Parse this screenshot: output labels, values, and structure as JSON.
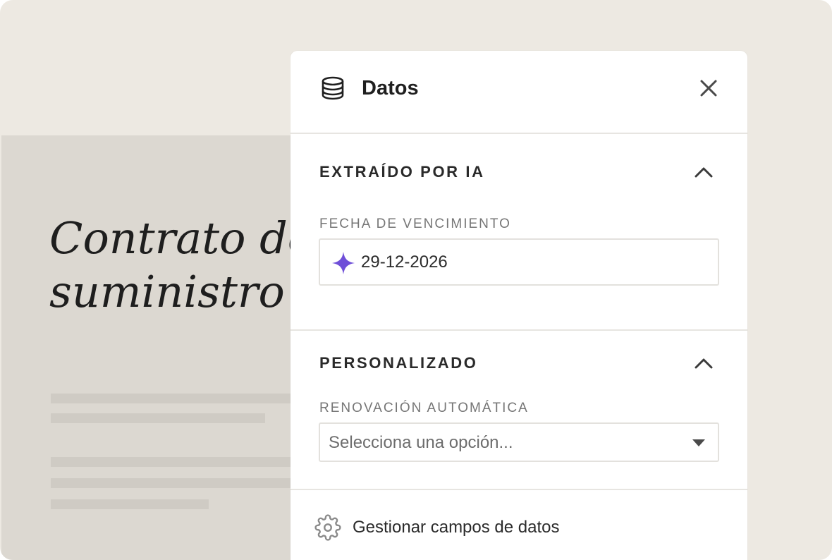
{
  "document": {
    "title_line1": "Contrato de",
    "title_line2": "suministro"
  },
  "panel": {
    "title": "Datos",
    "title_icon": "database-icon",
    "close_icon": "close-icon"
  },
  "sections": {
    "ai": {
      "title": "EXTRAÍDO POR IA",
      "chevron_icon": "chevron-up-icon",
      "field_label": "FECHA DE VENCIMIENTO",
      "field_value": "29-12-2026",
      "field_icon": "ai-sparkle-icon"
    },
    "custom": {
      "title": "PERSONALIZADO",
      "chevron_icon": "chevron-up-icon",
      "field_label": "RENOVACIÓN AUTOMÁTICA",
      "select_placeholder": "Selecciona una opción...",
      "select_icon": "caret-down-icon"
    }
  },
  "footer": {
    "label": "Gestionar campos de datos",
    "icon": "gear-icon"
  },
  "colors": {
    "background": "#ede9e2",
    "document": "#dcd8d1",
    "accent_sparkle": "#6f4fd8",
    "panel": "#ffffff"
  }
}
